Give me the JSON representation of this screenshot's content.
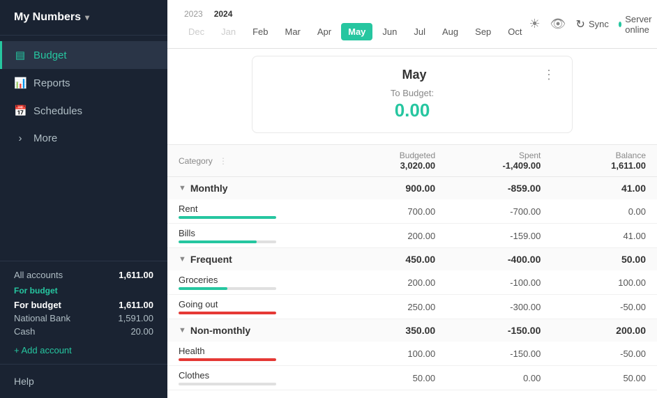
{
  "app": {
    "name": "My Numbers",
    "chevron": "▾"
  },
  "sidebar": {
    "nav_items": [
      {
        "id": "budget",
        "label": "Budget",
        "icon": "▤",
        "active": true
      },
      {
        "id": "reports",
        "label": "Reports",
        "icon": "📊",
        "active": false
      },
      {
        "id": "schedules",
        "label": "Schedules",
        "icon": "📅",
        "active": false
      },
      {
        "id": "more",
        "label": "More",
        "icon": "›",
        "active": false
      }
    ],
    "accounts_title": "All accounts",
    "accounts_total": "1,611.00",
    "for_budget_label": "For budget",
    "for_budget_total": "1,611.00",
    "accounts": [
      {
        "name": "National Bank",
        "balance": "1,591.00"
      },
      {
        "name": "Cash",
        "balance": "20.00"
      }
    ],
    "add_account": "+ Add account",
    "help_label": "Help"
  },
  "topbar": {
    "years": [
      "2023",
      "2024"
    ],
    "active_year": "2024",
    "months": [
      {
        "id": "dec",
        "label": "Dec",
        "disabled": true
      },
      {
        "id": "jan",
        "label": "Jan",
        "disabled": true
      },
      {
        "id": "feb",
        "label": "Feb"
      },
      {
        "id": "mar",
        "label": "Mar"
      },
      {
        "id": "apr",
        "label": "Apr"
      },
      {
        "id": "may",
        "label": "May",
        "active": true
      },
      {
        "id": "jun",
        "label": "Jun"
      },
      {
        "id": "jul",
        "label": "Jul"
      },
      {
        "id": "aug",
        "label": "Aug"
      },
      {
        "id": "sep",
        "label": "Sep"
      },
      {
        "id": "oct",
        "label": "Oct"
      }
    ],
    "sync_label": "Sync",
    "server_status": "Server online"
  },
  "may_card": {
    "title": "May",
    "budget_label": "To Budget:",
    "budget_value": "0.00"
  },
  "table": {
    "col_category": "Category",
    "col_budgeted": "Budgeted",
    "col_budgeted_total": "3,020.00",
    "col_spent": "Spent",
    "col_spent_total": "-1,409.00",
    "col_balance": "Balance",
    "col_balance_total": "1,611.00",
    "groups": [
      {
        "id": "monthly",
        "label": "Monthly",
        "budgeted": "900.00",
        "spent": "-859.00",
        "balance": "41.00",
        "balance_type": "positive",
        "categories": [
          {
            "name": "Rent",
            "budgeted": "700.00",
            "spent": "-700.00",
            "balance": "0.00",
            "balance_type": "zero",
            "progress": 100,
            "over": false
          },
          {
            "name": "Bills",
            "budgeted": "200.00",
            "spent": "-159.00",
            "balance": "41.00",
            "balance_type": "positive",
            "progress": 80,
            "over": false
          }
        ]
      },
      {
        "id": "frequent",
        "label": "Frequent",
        "budgeted": "450.00",
        "spent": "-400.00",
        "balance": "50.00",
        "balance_type": "positive",
        "categories": [
          {
            "name": "Groceries",
            "budgeted": "200.00",
            "spent": "-100.00",
            "balance": "100.00",
            "balance_type": "positive",
            "progress": 50,
            "over": false
          },
          {
            "name": "Going out",
            "budgeted": "250.00",
            "spent": "-300.00",
            "balance": "-50.00",
            "balance_type": "negative",
            "progress": 100,
            "over": true
          }
        ]
      },
      {
        "id": "non-monthly",
        "label": "Non-monthly",
        "budgeted": "350.00",
        "spent": "-150.00",
        "balance": "200.00",
        "balance_type": "positive",
        "categories": [
          {
            "name": "Health",
            "budgeted": "100.00",
            "spent": "-150.00",
            "balance": "-50.00",
            "balance_type": "negative",
            "progress": 100,
            "over": true
          },
          {
            "name": "Clothes",
            "budgeted": "50.00",
            "spent": "0.00",
            "balance": "50.00",
            "balance_type": "positive",
            "progress": 0,
            "over": false
          }
        ]
      }
    ]
  }
}
